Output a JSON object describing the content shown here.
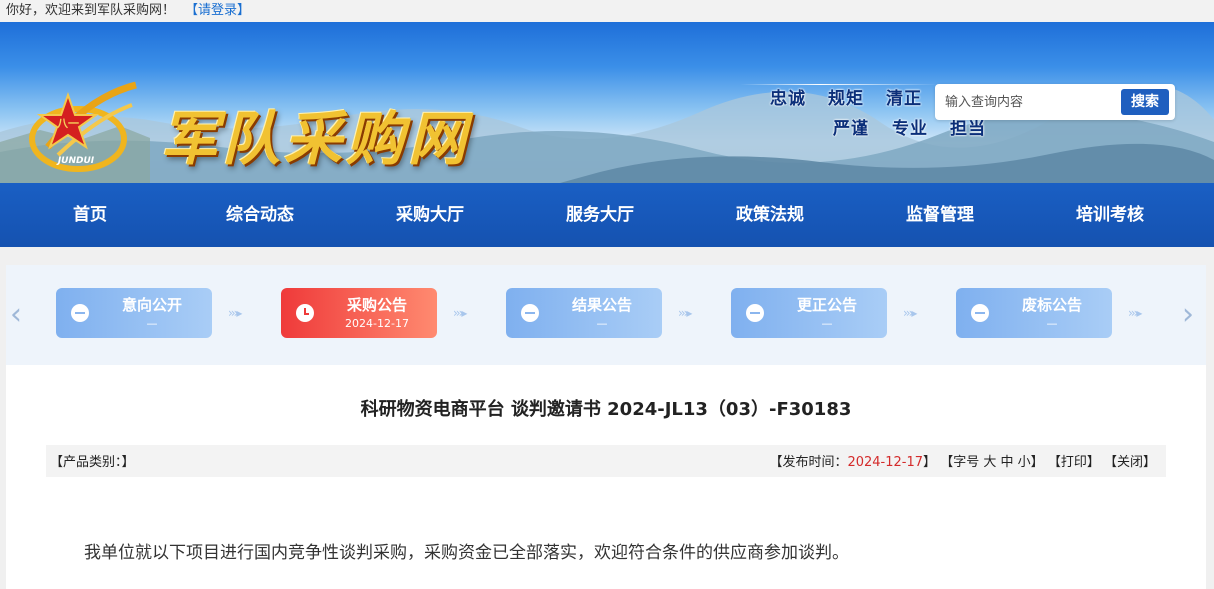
{
  "topbar": {
    "greeting": "你好，欢迎来到军队采购网！",
    "login": "【请登录】"
  },
  "header": {
    "site_title": "军队采购网",
    "emblem_text": "JUNDUI",
    "emblem_mark": "八一",
    "motto_row1": [
      "忠诚",
      "规矩",
      "清正"
    ],
    "motto_row2": [
      "严谨",
      "专业",
      "担当"
    ],
    "search": {
      "placeholder": "输入查询内容",
      "button": "搜索"
    }
  },
  "nav": [
    "首页",
    "综合动态",
    "采购大厅",
    "服务大厅",
    "政策法规",
    "监督管理",
    "培训考核"
  ],
  "steps": [
    {
      "label": "意向公开",
      "sub": "—",
      "active": false
    },
    {
      "label": "采购公告",
      "sub": "2024-12-17",
      "active": true
    },
    {
      "label": "结果公告",
      "sub": "—",
      "active": false
    },
    {
      "label": "更正公告",
      "sub": "—",
      "active": false
    },
    {
      "label": "废标公告",
      "sub": "—",
      "active": false
    }
  ],
  "steps_nav": {
    "prev": "‹",
    "next": "›"
  },
  "document": {
    "title": "科研物资电商平台 谈判邀请书 2024-JL13（03）-F30183",
    "category": "【产品类别：】",
    "publish_prefix": "【发布时间：",
    "publish_date": "2024-12-17",
    "publish_suffix": "】",
    "font_size_prefix": "【字号",
    "font_large": "大",
    "font_medium": "中",
    "font_small": "小",
    "font_size_suffix": "】",
    "print": "【打印】",
    "close": "【关闭】",
    "body_first_line": "我单位就以下项目进行国内竞争性谈判采购，采购资金已全部落实，欢迎符合条件的供应商参加谈判。"
  },
  "colors": {
    "nav_bg": "#1a5fc4",
    "active_step": "#ef3a3a",
    "inactive_step": "#8bb6ee",
    "date": "#d42b2b",
    "title_gold": "#f1c232"
  }
}
